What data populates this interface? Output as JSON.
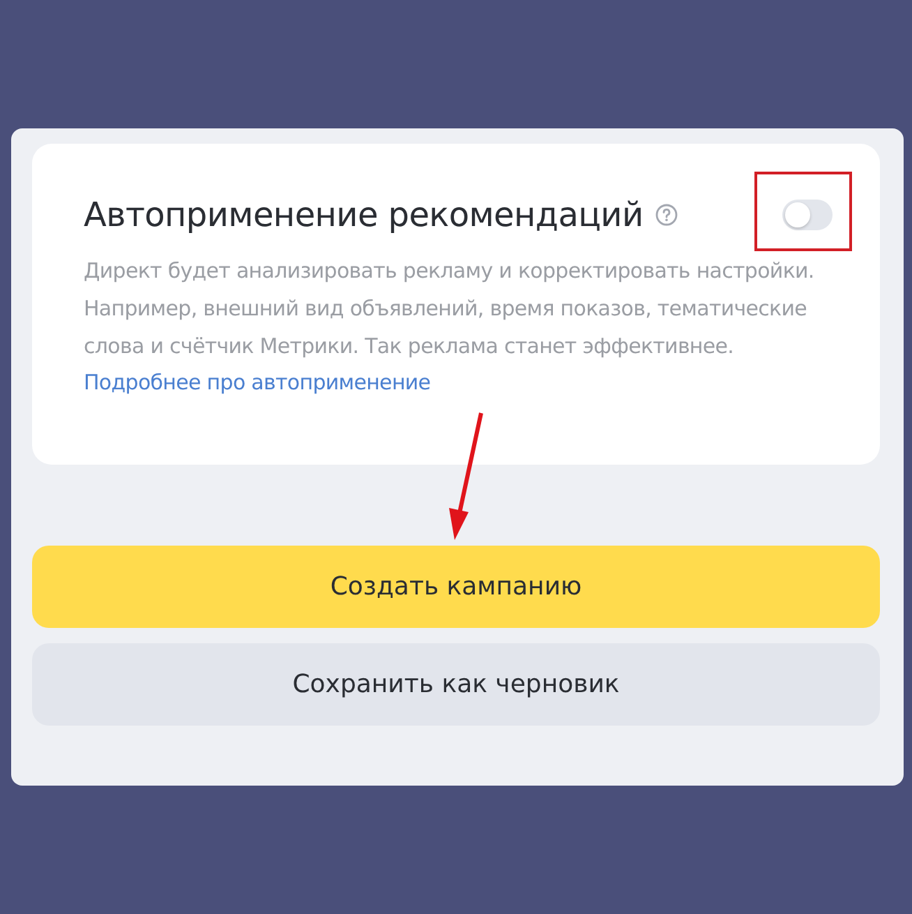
{
  "settings_card": {
    "title": "Автоприменение рекомендаций",
    "toggle": {
      "on": false
    },
    "description": "Директ будет анализировать рекламу и корректировать настройки. Например, внешний вид объявлений, время показов, тематические слова и счётчик Метрики. Так реклама станет эффективнее.",
    "link": "Подробнее про автоприменение"
  },
  "buttons": [
    {
      "label": "Создать кампанию",
      "kind": "primary"
    },
    {
      "label": "Сохранить как черновик",
      "kind": "secondary"
    }
  ]
}
